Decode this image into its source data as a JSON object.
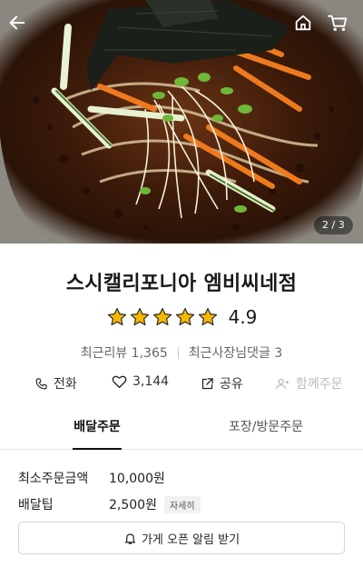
{
  "hero": {
    "photo_alt": "냉면 사진",
    "counter": "2 / 3"
  },
  "header": {
    "back_icon": "back-arrow-icon",
    "home_icon": "home-icon",
    "cart_icon": "cart-icon"
  },
  "store": {
    "name": "스시캘리포니아 엠비씨네점",
    "rating": "4.9",
    "stars": 5,
    "star_color": "#F5B800",
    "recent_reviews": "최근리뷰 1,365",
    "owner_replies": "최근사장님댓글 3"
  },
  "actions": {
    "call": "전화",
    "likes": "3,144",
    "share": "공유",
    "group_order": "함께주문"
  },
  "tabs": {
    "delivery": "배달주문",
    "pickup": "포장/방문주문"
  },
  "order_info": {
    "min_order_label": "최소주문금액",
    "min_order_value": "10,000원",
    "tip_label": "배달팁",
    "tip_value": "2,500원",
    "tip_detail": "자세히"
  },
  "notify": {
    "label": "가게 오픈 알림 받기"
  }
}
